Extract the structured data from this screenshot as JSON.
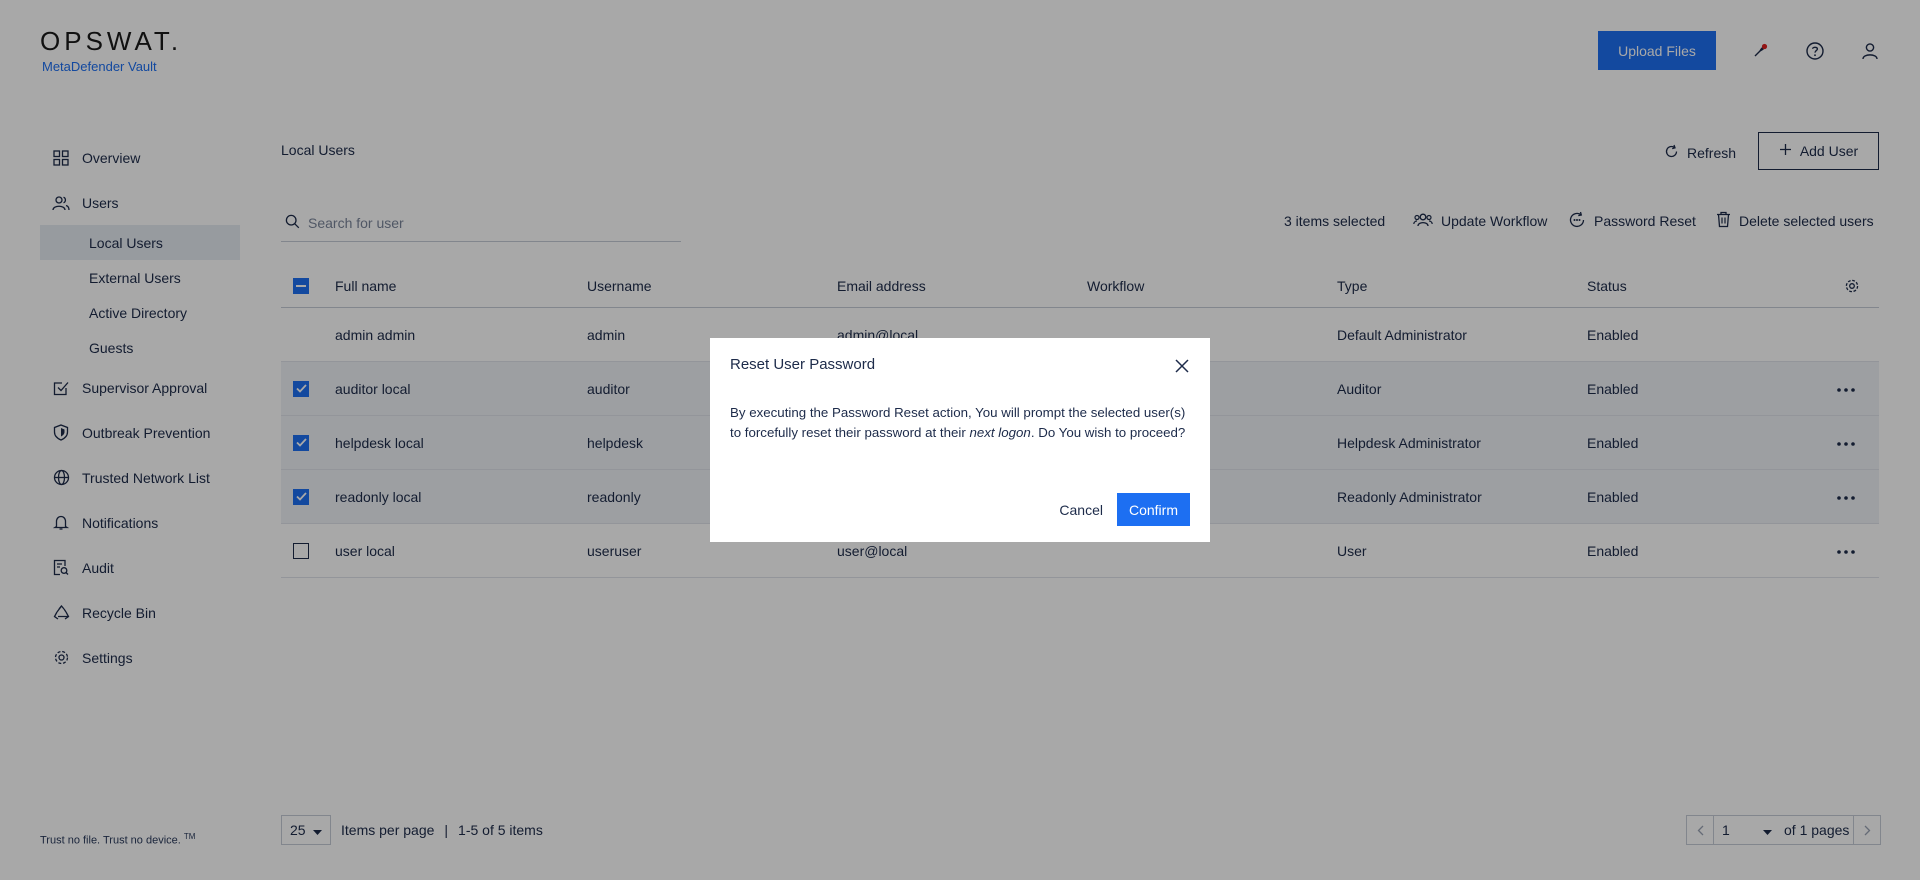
{
  "header": {
    "logo": "OPSWAT.",
    "product": "MetaDefender Vault",
    "upload_label": "Upload Files",
    "icons": [
      "rocket-icon",
      "help-icon",
      "user-icon"
    ]
  },
  "sidebar": {
    "items": [
      {
        "label": "Overview",
        "icon": "grid-icon"
      },
      {
        "label": "Users",
        "icon": "users-icon"
      },
      {
        "label": "Supervisor Approval",
        "icon": "approval-icon"
      },
      {
        "label": "Outbreak Prevention",
        "icon": "shield-icon"
      },
      {
        "label": "Trusted Network List",
        "icon": "globe-icon"
      },
      {
        "label": "Notifications",
        "icon": "bell-icon"
      },
      {
        "label": "Audit",
        "icon": "audit-icon"
      },
      {
        "label": "Recycle Bin",
        "icon": "recycle-icon"
      },
      {
        "label": "Settings",
        "icon": "gear-icon"
      }
    ],
    "users_sub": [
      "Local Users",
      "External Users",
      "Active Directory",
      "Guests"
    ],
    "footer": "Trust no file. Trust no device.",
    "footer_tm": "TM"
  },
  "main": {
    "title": "Local Users",
    "refresh_label": "Refresh",
    "add_user_label": "Add User",
    "search_placeholder": "Search for user",
    "selected_count": "3 items selected",
    "update_workflow": "Update Workflow",
    "password_reset": "Password Reset",
    "delete_selected": "Delete selected users"
  },
  "table": {
    "columns": [
      "Full name",
      "Username",
      "Email address",
      "Workflow",
      "Type",
      "Status"
    ],
    "rows": [
      {
        "full_name": "admin admin",
        "username": "admin",
        "email": "admin@local",
        "workflow": "",
        "type": "Default Administrator",
        "status": "Enabled",
        "checked": false
      },
      {
        "full_name": "auditor local",
        "username": "auditor",
        "email": "",
        "workflow": "",
        "type": "Auditor",
        "status": "Enabled",
        "checked": true
      },
      {
        "full_name": "helpdesk local",
        "username": "helpdesk",
        "email": "",
        "workflow": "",
        "type": "Helpdesk Administrator",
        "status": "Enabled",
        "checked": true
      },
      {
        "full_name": "readonly local",
        "username": "readonly",
        "email": "",
        "workflow": "",
        "type": "Readonly Administrator",
        "status": "Enabled",
        "checked": true
      },
      {
        "full_name": "user local",
        "username": "useruser",
        "email": "user@local",
        "workflow": "",
        "type": "User",
        "status": "Enabled",
        "checked": false
      }
    ]
  },
  "footer": {
    "per_page_value": "25",
    "per_page_label": "Items per page",
    "separator": "|",
    "range": "1-5 of 5 items",
    "page_value": "1",
    "of_pages": "of 1 pages"
  },
  "modal": {
    "title": "Reset User Password",
    "body_1": "By executing the Password Reset action, You will prompt the selected user(s) to forcefully reset their password at their ",
    "body_em": "next logon",
    "body_2": ". Do You wish to proceed?",
    "cancel": "Cancel",
    "confirm": "Confirm"
  },
  "colors": {
    "accent": "#1d6ff2",
    "text": "#1d2b4a",
    "overlay": "rgba(0,0,0,0.34)",
    "notification_dot": "#e02020"
  }
}
